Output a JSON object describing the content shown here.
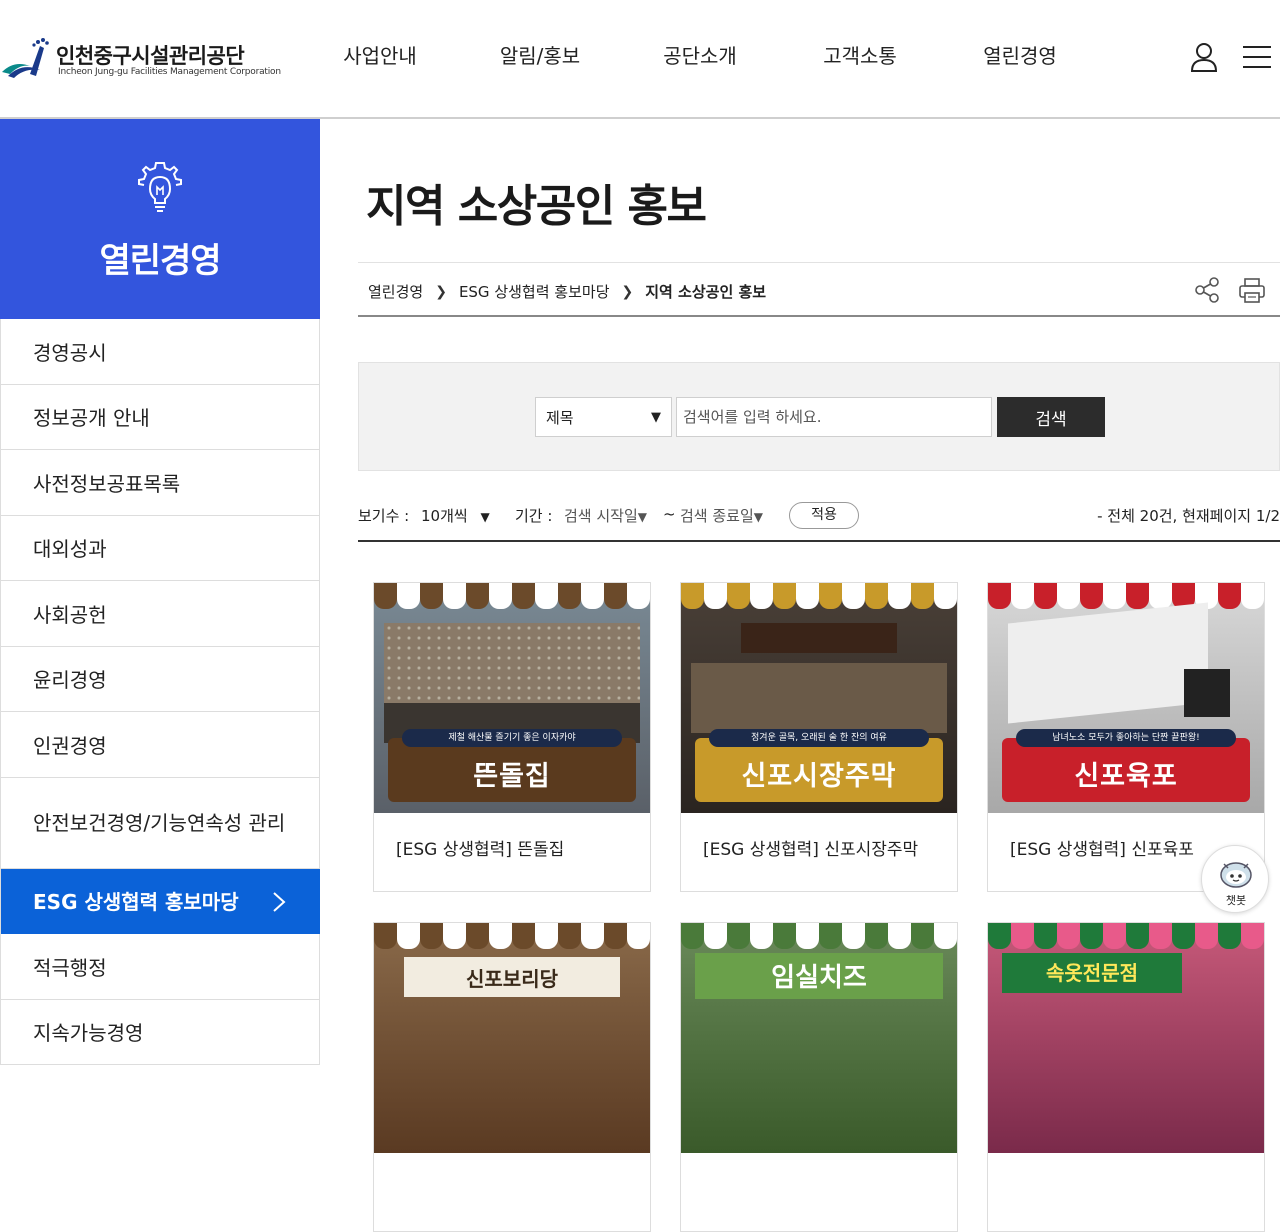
{
  "header": {
    "logo_title": "인천중구시설관리공단",
    "logo_sub": "Incheon Jung-gu Facilities Management Corporation",
    "nav": [
      "사업안내",
      "알림/홍보",
      "공단소개",
      "고객소통",
      "열린경영"
    ]
  },
  "sidebar": {
    "title": "열린경영",
    "items": [
      {
        "label": "경영공시"
      },
      {
        "label": "정보공개 안내"
      },
      {
        "label": "사전정보공표목록"
      },
      {
        "label": "대외성과"
      },
      {
        "label": "사회공헌"
      },
      {
        "label": "윤리경영"
      },
      {
        "label": "인권경영"
      },
      {
        "label": "안전보건경영/기능연속성 관리"
      },
      {
        "label": "ESG 상생협력 홍보마당"
      },
      {
        "label": "적극행정"
      },
      {
        "label": "지속가능경영"
      }
    ]
  },
  "page": {
    "title": "지역 소상공인 홍보",
    "breadcrumb": [
      "열린경영",
      "ESG 상생협력 홍보마당",
      "지역 소상공인 홍보"
    ]
  },
  "search": {
    "field": "제목",
    "placeholder": "검색어를 입력 하세요.",
    "button": "검색"
  },
  "filter": {
    "view_label": "보기수 :",
    "view_value": "10개씩",
    "period_label": "기간 :",
    "start": "검색 시작일",
    "tilde": "~",
    "end": "검색 종료일",
    "apply": "적용",
    "total": "- 전체 20건, 현재페이지 1/2"
  },
  "cards": [
    {
      "caption": "[ESG 상생협력] 뜬돌집",
      "sign_tag": "제철 해산물 즐기기 좋은 이자카야",
      "sign_name": "뜬돌집",
      "color": "#5a3a1e"
    },
    {
      "caption": "[ESG 상생협력] 신포시장주막",
      "sign_tag": "정겨운 골목, 오래된 술 한 잔의 여유",
      "sign_name": "신포시장주막",
      "color": "#c89a2a"
    },
    {
      "caption": "[ESG 상생협력] 신포육포",
      "sign_tag": "남녀노소 모두가 좋아하는 단짠 끝판왕!",
      "sign_name": "신포육포",
      "color": "#c8202a"
    },
    {
      "caption": "",
      "sign_tag": "",
      "sign_name": "신포보리당",
      "color": "#6b4a2a"
    },
    {
      "caption": "",
      "sign_tag": "",
      "sign_name": "임실치즈",
      "color": "#4a7a3a"
    },
    {
      "caption": "",
      "sign_tag": "",
      "sign_name": "속옷전문점",
      "color": "#1f7a3a"
    }
  ],
  "chatbot": {
    "label": "챗봇"
  }
}
